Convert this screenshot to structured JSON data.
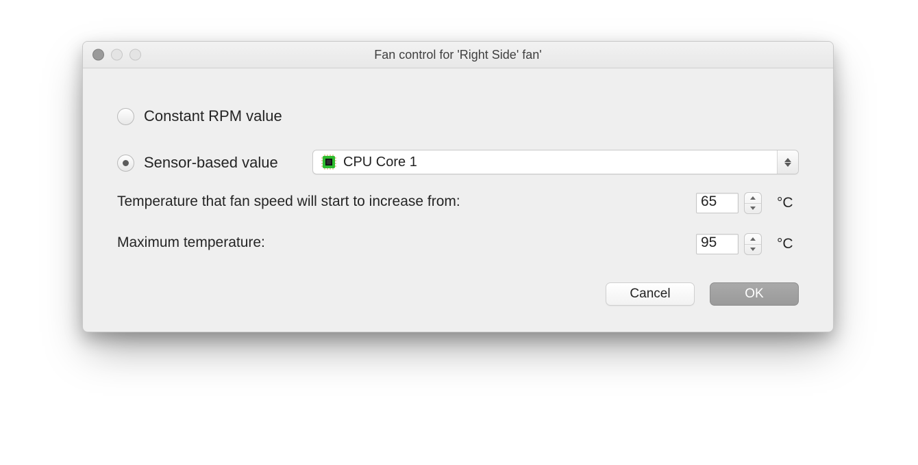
{
  "window": {
    "title": "Fan control for 'Right Side' fan'"
  },
  "mode": {
    "constant_label": "Constant RPM value",
    "sensor_label": "Sensor-based value",
    "selected": "sensor"
  },
  "sensor_select": {
    "value": "CPU Core 1"
  },
  "fields": {
    "start_temp_label": "Temperature that fan speed will start to increase from:",
    "start_temp_value": "65",
    "max_temp_label": "Maximum temperature:",
    "max_temp_value": "95",
    "unit": "°C"
  },
  "buttons": {
    "cancel": "Cancel",
    "ok": "OK"
  }
}
